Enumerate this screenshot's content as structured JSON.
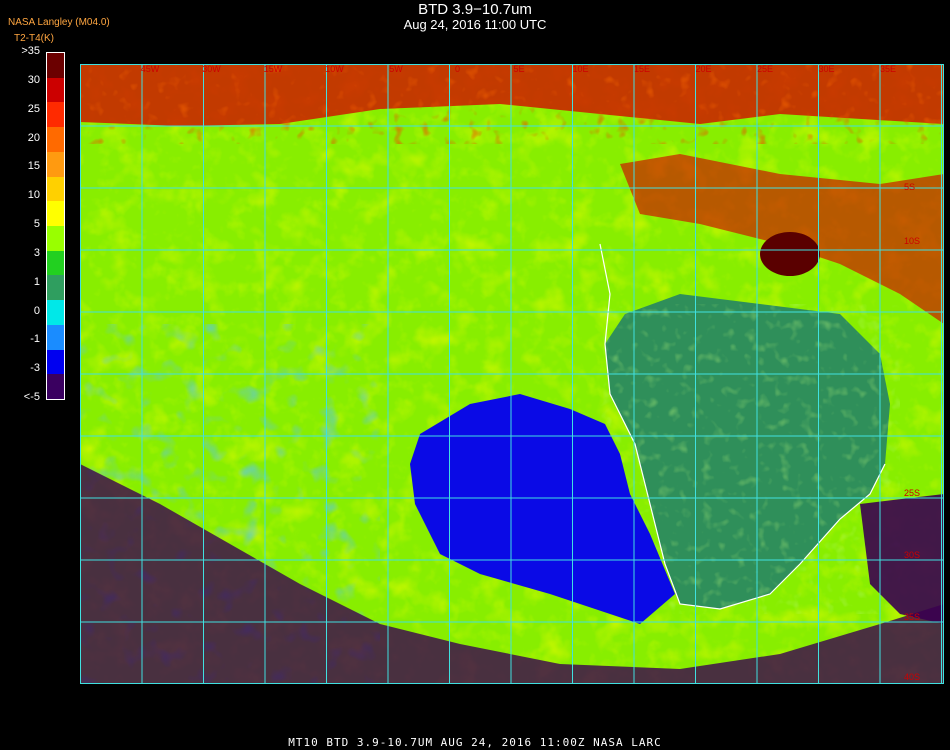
{
  "header": {
    "title": "BTD 3.9−10.7um",
    "subtitle": "Aug 24, 2016 11:00 UTC",
    "credit_org": "NASA Langley (M04.0)",
    "credit_var": "T2-T4(K)"
  },
  "legend": {
    "labels": [
      ">35",
      "30",
      "25",
      "20",
      "15",
      "10",
      "5",
      "3",
      "1",
      "0",
      "-1",
      "-3",
      "<-5"
    ],
    "colors": [
      "#6b0000",
      "#cc0000",
      "#ff2a00",
      "#ff6a00",
      "#ff9a10",
      "#ffd000",
      "#ffff00",
      "#99ff00",
      "#22d020",
      "#2f9e5f",
      "#00e8e8",
      "#1a8cff",
      "#0000f0",
      "#3a0060"
    ]
  },
  "map": {
    "lon_labels_top": [
      "45W",
      "30W",
      "15W",
      "10W",
      "5W",
      "0",
      "5E",
      "10E",
      "15E",
      "20E",
      "25E",
      "30E",
      "35E"
    ],
    "lat_labels_right": [
      "5S",
      "10S",
      "25S",
      "30S",
      "35S",
      "40S"
    ],
    "colors": {
      "grid": "#40e0e0",
      "ocean_clear": "#0a0ae6",
      "land_clear": "#2f8f5a",
      "cloud_warm": "#ffff00",
      "cloud_green": "#88ee00",
      "hot": "#cc1a00",
      "dark": "#5a0000",
      "cold": "#3a0050",
      "coast": "#ffffff"
    }
  },
  "footer": {
    "text": "MT10   BTD 3.9-10.7UM   AUG 24, 2016 11:00Z   NASA LARC"
  }
}
